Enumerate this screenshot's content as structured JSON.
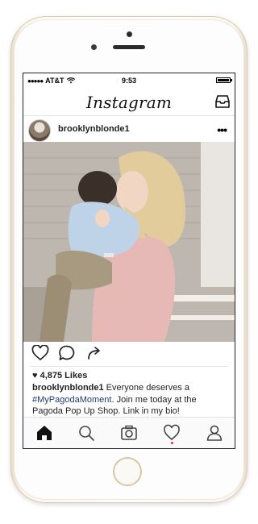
{
  "status_bar": {
    "carrier": "AT&T",
    "time": "9:53",
    "signal": "●●●●●"
  },
  "app": {
    "logo_text": "Instagram"
  },
  "post": {
    "username": "brooklynblonde1",
    "more_label": "•••",
    "likes": "4,875 Likes",
    "caption": {
      "username": "brooklynblonde1",
      "text_1": " Everyone deserves a ",
      "hashtag": "#MyPagodaMoment",
      "text_2": ". Join me today at the Pagoda Pop Up Shop. Link in my bio!"
    }
  },
  "tab_bar": {
    "tabs": [
      {
        "icon": "home-icon",
        "active": true
      },
      {
        "icon": "search-icon",
        "active": false
      },
      {
        "icon": "camera-icon",
        "active": false
      },
      {
        "icon": "heart-icon",
        "active": false,
        "notification": true
      },
      {
        "icon": "profile-icon",
        "active": false
      }
    ]
  },
  "colors": {
    "hashtag": "#1d3e6e",
    "notification_dot": "#e8334a",
    "phone_gold": "#d9c6a6"
  }
}
